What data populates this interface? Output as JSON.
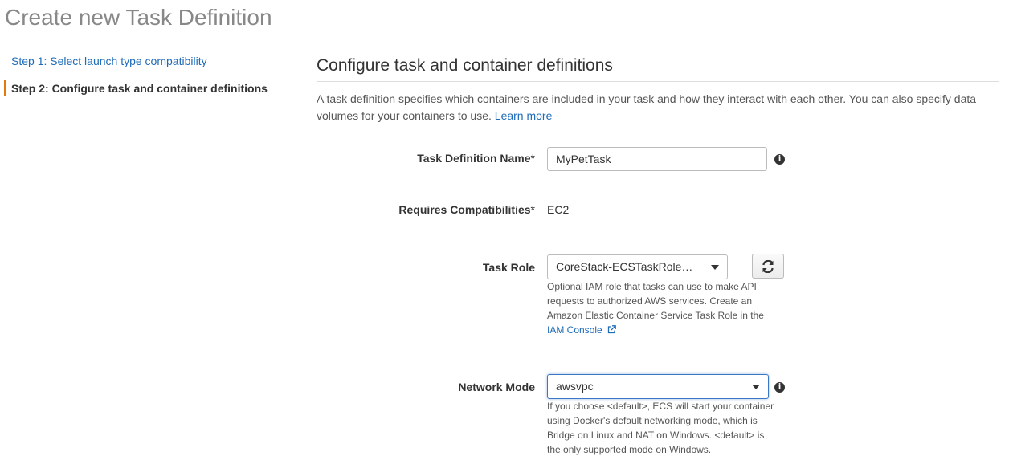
{
  "page_title": "Create new Task Definition",
  "steps": [
    {
      "label": "Step 1: Select launch type compatibility"
    },
    {
      "label": "Step 2: Configure task and container definitions"
    }
  ],
  "section": {
    "title": "Configure task and container definitions",
    "intro": "A task definition specifies which containers are included in your task and how they interact with each other. You can also specify data volumes for your containers to use.",
    "learn_more": "Learn more"
  },
  "fields": {
    "task_definition_name": {
      "label": "Task Definition Name",
      "required_mark": "*",
      "value": "MyPetTask"
    },
    "requires_compatibilities": {
      "label": "Requires Compatibilities",
      "required_mark": "*",
      "value": "EC2"
    },
    "task_role": {
      "label": "Task Role",
      "value": "CoreStack-ECSTaskRoleP…",
      "help": "Optional IAM role that tasks can use to make API requests to authorized AWS services. Create an Amazon Elastic Container Service Task Role in the",
      "help_link": "IAM Console"
    },
    "network_mode": {
      "label": "Network Mode",
      "value": "awsvpc",
      "help": "If you choose <default>, ECS will start your container using Docker's default networking mode, which is Bridge on Linux and NAT on Windows. <default> is the only supported mode on Windows."
    }
  },
  "colors": {
    "link": "#1e6bb8",
    "step_marker": "#e07b0a",
    "focus_border": "#3a78c3"
  },
  "icons": {
    "info": "info-icon",
    "refresh": "refresh-icon",
    "external_link": "external-link-icon",
    "caret": "chevron-down-icon"
  }
}
